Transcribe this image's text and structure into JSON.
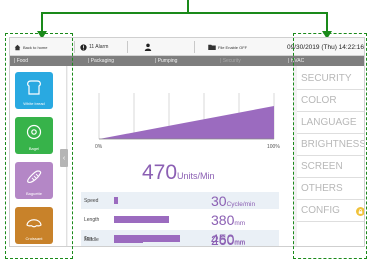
{
  "topbar": {
    "back_label": "Back to home",
    "alarm_label": "11 Alarm",
    "file_label": "File Enable OFF",
    "datetime": "09/30/2019 (Thu) 14:22:16"
  },
  "tabs": [
    {
      "label": "| Food",
      "active": true
    },
    {
      "label": "| Packaging",
      "active": true
    },
    {
      "label": "| Pumping",
      "active": true
    },
    {
      "label": "| Security",
      "active": false
    },
    {
      "label": "| HVAC",
      "active": true
    }
  ],
  "products": [
    {
      "label": "White bread",
      "icon": "bread-icon",
      "color": "#29a9e1"
    },
    {
      "label": "Bagel",
      "icon": "bagel-icon",
      "color": "#37b34a"
    },
    {
      "label": "Baguette",
      "icon": "baguette-icon",
      "color": "#b487c6"
    },
    {
      "label": "Croissant",
      "icon": "croissant-icon",
      "color": "#c8822a"
    }
  ],
  "chart": {
    "axis_min_label": "0%",
    "axis_max_label": "100%"
  },
  "speed": {
    "value": "470",
    "unit": "Units/Min"
  },
  "parameters": [
    {
      "label": "Speed",
      "value": "30",
      "unit": "Cycle/min",
      "fill": 0.04
    },
    {
      "label": "Length",
      "value": "380",
      "unit": "mm",
      "fill": 0.6
    },
    {
      "label": "Top",
      "value": "450",
      "unit": "mm",
      "fill": 0.72
    },
    {
      "label": "Middle",
      "value": "260",
      "unit": "mm",
      "fill": 0.31
    }
  ],
  "menu": [
    {
      "label": "SECURITY"
    },
    {
      "label": "COLOR"
    },
    {
      "label": "LANGUAGE"
    },
    {
      "label": "BRIGHTNESS"
    },
    {
      "label": "SCREEN"
    },
    {
      "label": "OTHERS"
    },
    {
      "label": "CONFIG"
    }
  ],
  "colors": {
    "accent": "#9b6bbf",
    "callout": "#1a8a1a",
    "tabbar": "#7e7e7e"
  }
}
